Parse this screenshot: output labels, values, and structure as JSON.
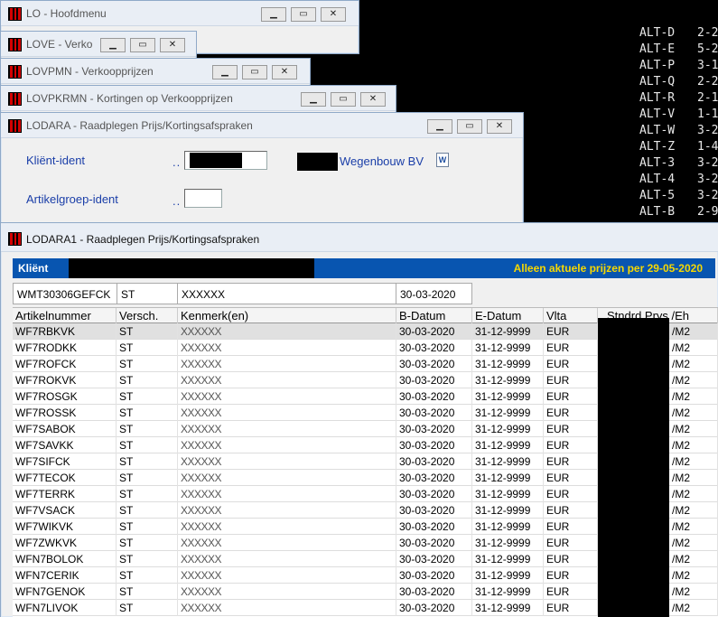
{
  "alt_list": [
    {
      "key": "ALT-D",
      "value": "2-2"
    },
    {
      "key": "ALT-E",
      "value": "5-2"
    },
    {
      "key": "ALT-P",
      "value": "3-1"
    },
    {
      "key": "ALT-Q",
      "value": "2-2"
    },
    {
      "key": "ALT-R",
      "value": "2-1"
    },
    {
      "key": "ALT-V",
      "value": "1-1"
    },
    {
      "key": "ALT-W",
      "value": "3-2"
    },
    {
      "key": "ALT-Z",
      "value": "1-4"
    },
    {
      "key": "ALT-3",
      "value": "3-2"
    },
    {
      "key": "ALT-4",
      "value": "3-2"
    },
    {
      "key": "ALT-5",
      "value": "3-2"
    },
    {
      "key": "ALT-B",
      "value": "2-9"
    }
  ],
  "windows": {
    "lo": {
      "title": "LO - Hoofdmenu"
    },
    "love": {
      "title": "LOVE - Verko"
    },
    "lovpmn": {
      "title": "LOVPMN - Verkoopprijzen"
    },
    "lovpkrmn": {
      "title": "LOVPKRMN - Kortingen op Verkoopprijzen"
    },
    "lodara": {
      "title": "LODARA - Raadplegen Prijs/Kortingsafspraken"
    },
    "lodara1": {
      "title": "LODARA1 - Raadplegen Prijs/Kortingsafspraken"
    }
  },
  "controls": {
    "minimize": "▁",
    "maximize": "▭",
    "close": "✕"
  },
  "lodara_form": {
    "klient_label": "Kliënt-ident",
    "klient_dots": "..",
    "klient_name": "Wegenbouw BV",
    "artikel_label": "Artikelgroep-ident",
    "artikel_dots": "..",
    "artikel_value": ""
  },
  "lodara1": {
    "band_label": "Kliënt",
    "band_note": "Alleen aktuele prijzen per 29-05-2020",
    "info": {
      "code": "WMT30306GEFCK",
      "versch": "ST",
      "kenmerk": "XXXXXX",
      "datum": "30-03-2020"
    },
    "headers": [
      "Artikelnummer",
      "Versch.",
      "Kenmerk(en)",
      "B-Datum",
      "E-Datum",
      "Vlta",
      "Stndrd Prys /Eh"
    ],
    "rows": [
      {
        "art": "WF7RBKVK",
        "versch": "ST",
        "kenmerk": "XXXXXX",
        "b": "30-03-2020",
        "e": "31-12-9999",
        "vlta": "EUR",
        "eh": "/M2"
      },
      {
        "art": "WF7RODKK",
        "versch": "ST",
        "kenmerk": "XXXXXX",
        "b": "30-03-2020",
        "e": "31-12-9999",
        "vlta": "EUR",
        "eh": "/M2"
      },
      {
        "art": "WF7ROFCK",
        "versch": "ST",
        "kenmerk": "XXXXXX",
        "b": "30-03-2020",
        "e": "31-12-9999",
        "vlta": "EUR",
        "eh": "/M2"
      },
      {
        "art": "WF7ROKVK",
        "versch": "ST",
        "kenmerk": "XXXXXX",
        "b": "30-03-2020",
        "e": "31-12-9999",
        "vlta": "EUR",
        "eh": "/M2"
      },
      {
        "art": "WF7ROSGK",
        "versch": "ST",
        "kenmerk": "XXXXXX",
        "b": "30-03-2020",
        "e": "31-12-9999",
        "vlta": "EUR",
        "eh": "/M2"
      },
      {
        "art": "WF7ROSSK",
        "versch": "ST",
        "kenmerk": "XXXXXX",
        "b": "30-03-2020",
        "e": "31-12-9999",
        "vlta": "EUR",
        "eh": "/M2"
      },
      {
        "art": "WF7SABOK",
        "versch": "ST",
        "kenmerk": "XXXXXX",
        "b": "30-03-2020",
        "e": "31-12-9999",
        "vlta": "EUR",
        "eh": "/M2"
      },
      {
        "art": "WF7SAVKK",
        "versch": "ST",
        "kenmerk": "XXXXXX",
        "b": "30-03-2020",
        "e": "31-12-9999",
        "vlta": "EUR",
        "eh": "/M2"
      },
      {
        "art": "WF7SIFCK",
        "versch": "ST",
        "kenmerk": "XXXXXX",
        "b": "30-03-2020",
        "e": "31-12-9999",
        "vlta": "EUR",
        "eh": "/M2"
      },
      {
        "art": "WF7TECOK",
        "versch": "ST",
        "kenmerk": "XXXXXX",
        "b": "30-03-2020",
        "e": "31-12-9999",
        "vlta": "EUR",
        "eh": "/M2"
      },
      {
        "art": "WF7TERRK",
        "versch": "ST",
        "kenmerk": "XXXXXX",
        "b": "30-03-2020",
        "e": "31-12-9999",
        "vlta": "EUR",
        "eh": "/M2"
      },
      {
        "art": "WF7VSACK",
        "versch": "ST",
        "kenmerk": "XXXXXX",
        "b": "30-03-2020",
        "e": "31-12-9999",
        "vlta": "EUR",
        "eh": "/M2"
      },
      {
        "art": "WF7WIKVK",
        "versch": "ST",
        "kenmerk": "XXXXXX",
        "b": "30-03-2020",
        "e": "31-12-9999",
        "vlta": "EUR",
        "eh": "/M2"
      },
      {
        "art": "WF7ZWKVK",
        "versch": "ST",
        "kenmerk": "XXXXXX",
        "b": "30-03-2020",
        "e": "31-12-9999",
        "vlta": "EUR",
        "eh": "/M2"
      },
      {
        "art": "WFN7BOLOK",
        "versch": "ST",
        "kenmerk": "XXXXXX",
        "b": "30-03-2020",
        "e": "31-12-9999",
        "vlta": "EUR",
        "eh": "/M2"
      },
      {
        "art": "WFN7CERIK",
        "versch": "ST",
        "kenmerk": "XXXXXX",
        "b": "30-03-2020",
        "e": "31-12-9999",
        "vlta": "EUR",
        "eh": "/M2"
      },
      {
        "art": "WFN7GENOK",
        "versch": "ST",
        "kenmerk": "XXXXXX",
        "b": "30-03-2020",
        "e": "31-12-9999",
        "vlta": "EUR",
        "eh": "/M2"
      },
      {
        "art": "WFN7LIVOK",
        "versch": "ST",
        "kenmerk": "XXXXXX",
        "b": "30-03-2020",
        "e": "31-12-9999",
        "vlta": "EUR",
        "eh": "/M2"
      }
    ]
  },
  "colors": {
    "band": "#0855b0",
    "note": "#f7d800",
    "label_blue": "#1a3ea8",
    "app_icon_red": "#d40000"
  }
}
